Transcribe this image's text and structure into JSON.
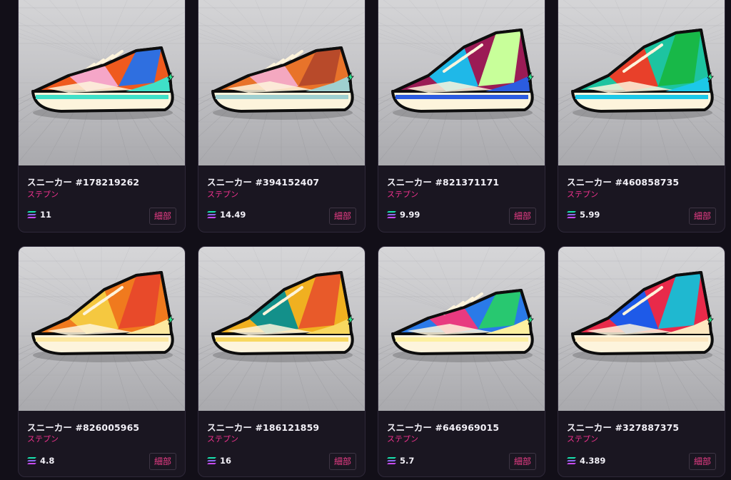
{
  "collection": {
    "cards": [
      {
        "title": "スニーカー #178219262",
        "subtitle": "ステプン",
        "price": "11",
        "button": "細部",
        "colors": [
          "#ef5a1e",
          "#f5a6c8",
          "#2f6fe0",
          "#3fe0c8"
        ]
      },
      {
        "title": "スニーカー #394152407",
        "subtitle": "ステプン",
        "price": "14.49",
        "button": "細部",
        "colors": [
          "#e8732a",
          "#f4a8c0",
          "#b84a2a",
          "#9fd0d0"
        ]
      },
      {
        "title": "スニーカー #821371171",
        "subtitle": "ステプン",
        "price": "9.99",
        "button": "細部",
        "colors": [
          "#9b1b55",
          "#1fb8e8",
          "#c8ff9a",
          "#2b5ce0"
        ]
      },
      {
        "title": "スニーカー #460858735",
        "subtitle": "ステプン",
        "price": "5.99",
        "button": "細部",
        "colors": [
          "#1dc4a0",
          "#e8402a",
          "#18b848",
          "#1cc8e8"
        ]
      },
      {
        "title": "スニーカー #826005965",
        "subtitle": "ステプン",
        "price": "4.8",
        "button": "細部",
        "colors": [
          "#f07a1e",
          "#f5c840",
          "#e84a2a",
          "#fde8a0"
        ]
      },
      {
        "title": "スニーカー #186121859",
        "subtitle": "ステプン",
        "price": "16",
        "button": "細部",
        "colors": [
          "#f0b020",
          "#13908a",
          "#e85a2a",
          "#f8d860"
        ]
      },
      {
        "title": "スニーカー #646969015",
        "subtitle": "ステプン",
        "price": "5.7",
        "button": "細部",
        "colors": [
          "#2a7ae8",
          "#e83a80",
          "#28c870",
          "#fdf0a0"
        ]
      },
      {
        "title": "スニーカー #327887375",
        "subtitle": "ステプン",
        "price": "4.389",
        "button": "細部",
        "colors": [
          "#e82a4a",
          "#1e5ae8",
          "#1fb8d0",
          "#fde8c0"
        ]
      }
    ]
  },
  "icons": {
    "price_currency": "solana-icon",
    "energy_badge": "lightning-icon"
  },
  "theme": {
    "background": "#120f18",
    "card": "#1a1621",
    "accent": "#f0328e"
  }
}
